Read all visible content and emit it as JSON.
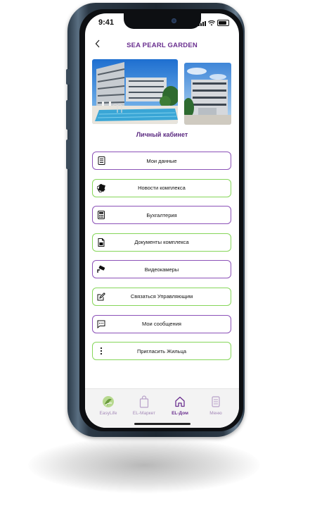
{
  "status_bar": {
    "time": "9:41"
  },
  "header": {
    "title": "SEA PEARL GARDEN",
    "back_icon": "chevron-left-icon"
  },
  "section": {
    "title": "Личный кабинет"
  },
  "menu": {
    "items": [
      {
        "label": "Мои данные",
        "icon": "document-list-icon",
        "border": "purple"
      },
      {
        "label": "Новости комплекса",
        "icon": "newspaper-icon",
        "border": "green"
      },
      {
        "label": "Бухгалтерия",
        "icon": "calculator-icon",
        "border": "purple"
      },
      {
        "label": "Документы комплекса",
        "icon": "file-icon",
        "border": "green"
      },
      {
        "label": "Видеокамеры",
        "icon": "cctv-camera-icon",
        "border": "purple"
      },
      {
        "label": "Связаться Управляющим",
        "icon": "edit-icon",
        "border": "green"
      },
      {
        "label": "Мои сообщения",
        "icon": "message-icon",
        "border": "purple"
      },
      {
        "label": "Пригласить Жильца",
        "icon": "more-vertical-icon",
        "border": "green"
      }
    ]
  },
  "bottom_nav": {
    "items": [
      {
        "label": "EasyLife",
        "icon": "easylife-logo-icon"
      },
      {
        "label": "EL-Маркет",
        "icon": "shopping-bag-icon"
      },
      {
        "label": "EL-Дом",
        "icon": "home-icon",
        "active": true
      },
      {
        "label": "Меню",
        "icon": "menu-list-icon"
      }
    ]
  },
  "colors": {
    "accent_purple": "#6a2f8f",
    "border_purple": "#8c52b8",
    "border_green": "#86d65a"
  }
}
